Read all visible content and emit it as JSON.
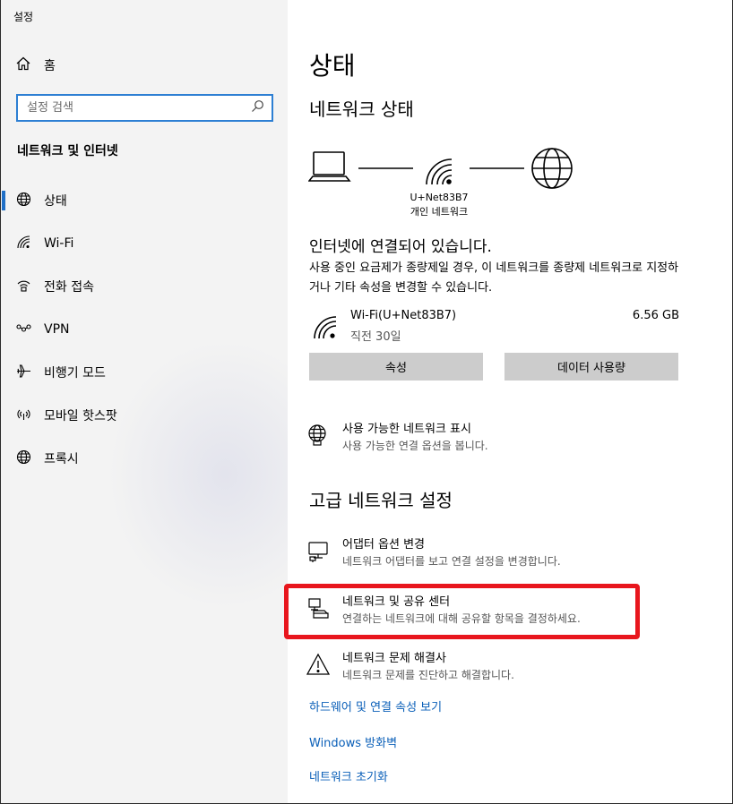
{
  "window": {
    "title": "설정"
  },
  "sidebar": {
    "home_label": "홈",
    "search_placeholder": "설정 검색",
    "section_title": "네트워크 및 인터넷",
    "items": [
      {
        "label": "상태",
        "icon": "globe-icon",
        "active": true
      },
      {
        "label": "Wi-Fi",
        "icon": "wifi-icon",
        "active": false
      },
      {
        "label": "전화 접속",
        "icon": "dialup-icon",
        "active": false
      },
      {
        "label": "VPN",
        "icon": "vpn-icon",
        "active": false
      },
      {
        "label": "비행기 모드",
        "icon": "airplane-icon",
        "active": false
      },
      {
        "label": "모바일 핫스팟",
        "icon": "hotspot-icon",
        "active": false
      },
      {
        "label": "프록시",
        "icon": "proxy-globe-icon",
        "active": false
      }
    ]
  },
  "main": {
    "title": "상태",
    "network_status_heading": "네트워크 상태",
    "network_name": "U+Net83B7",
    "network_type": "개인 네트워크",
    "status_heading": "인터넷에 연결되어 있습니다.",
    "status_description": "사용 중인 요금제가 종량제일 경우, 이 네트워크를 종량제 네트워크로 지정하거나 기타 속성을 변경할 수 있습니다.",
    "connection": {
      "name": "Wi-Fi(U+Net83B7)",
      "time": "직전 30일",
      "usage": "6.56 GB"
    },
    "buttons": {
      "properties": "속성",
      "data_usage": "데이터 사용량"
    },
    "show_networks": {
      "title": "사용 가능한 네트워크 표시",
      "desc": "사용 가능한 연결 옵션을 봅니다."
    },
    "advanced_heading": "고급 네트워크 설정",
    "adapter_options": {
      "title": "어댑터 옵션 변경",
      "desc": "네트워크 어댑터를 보고 연결 설정을 변경합니다."
    },
    "sharing_center": {
      "title": "네트워크 및 공유 센터",
      "desc": "연결하는 네트워크에 대해 공유할 항목을 결정하세요."
    },
    "troubleshooter": {
      "title": "네트워크 문제 해결사",
      "desc": "네트워크 문제를 진단하고 해결합니다."
    },
    "links": [
      "하드웨어 및 연결 속성 보기",
      "Windows 방화벽",
      "네트워크 초기화"
    ]
  },
  "colors": {
    "accent": "#1f6fc6",
    "link": "#0a5fb8",
    "highlight": "#e8161d",
    "sidebar_bg": "#f3f3f3",
    "button_bg": "#cccccc"
  }
}
